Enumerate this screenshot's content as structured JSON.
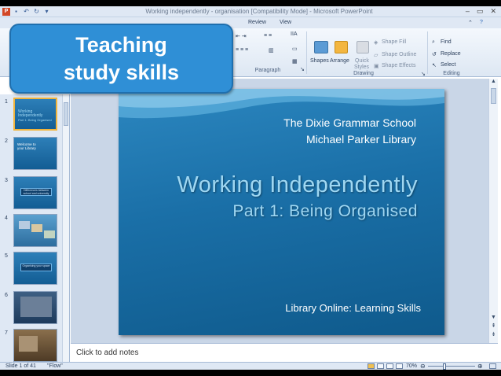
{
  "window": {
    "title": "Working independently - organisation [Compatibility Mode] - Microsoft PowerPoint",
    "app_icon": "P"
  },
  "badge": {
    "line1": "Teaching",
    "line2": "study skills"
  },
  "ribbon": {
    "tabs": [
      "Review",
      "View"
    ],
    "groups": {
      "paragraph_label": "Paragraph",
      "drawing_label": "Drawing",
      "editing_label": "Editing"
    },
    "drawing": {
      "shapes": "Shapes",
      "arrange": "Arrange",
      "quick_styles_1": "Quick",
      "quick_styles_2": "Styles",
      "shape_fill": "Shape Fill",
      "shape_outline": "Shape Outline",
      "shape_effects": "Shape Effects"
    },
    "editing": {
      "find": "Find",
      "replace": "Replace",
      "select": "Select"
    }
  },
  "slide_panel": {
    "thumbnails": [
      {
        "number": "1",
        "title": "Working Independently",
        "subtitle": "Part 1: Being Organised"
      },
      {
        "number": "2",
        "title": "Welcome to your Library",
        "subtitle": ""
      },
      {
        "number": "3",
        "title": "Differences between school and university",
        "subtitle": ""
      },
      {
        "number": "4",
        "title": "",
        "subtitle": ""
      },
      {
        "number": "5",
        "title": "Organising your space",
        "subtitle": ""
      },
      {
        "number": "6",
        "title": "",
        "subtitle": ""
      },
      {
        "number": "7",
        "title": "",
        "subtitle": ""
      }
    ]
  },
  "slide": {
    "school": "The Dixie Grammar School",
    "library": "Michael Parker Library",
    "title": "Working Independently",
    "subtitle": "Part 1: Being Organised",
    "footer": "Library Online: Learning Skills"
  },
  "notes": {
    "placeholder": "Click to add notes"
  },
  "status": {
    "slide_info": "Slide 1 of 41",
    "theme": "\"Flow\"",
    "zoom": "70%",
    "zoom_fraction": 0.7
  },
  "colors": {
    "badge_blue": "#2f8fd6",
    "slide_blue": "#1a6fa7",
    "title_cyan": "#9fd7f2",
    "selected_thumb": "#f0b43d"
  }
}
